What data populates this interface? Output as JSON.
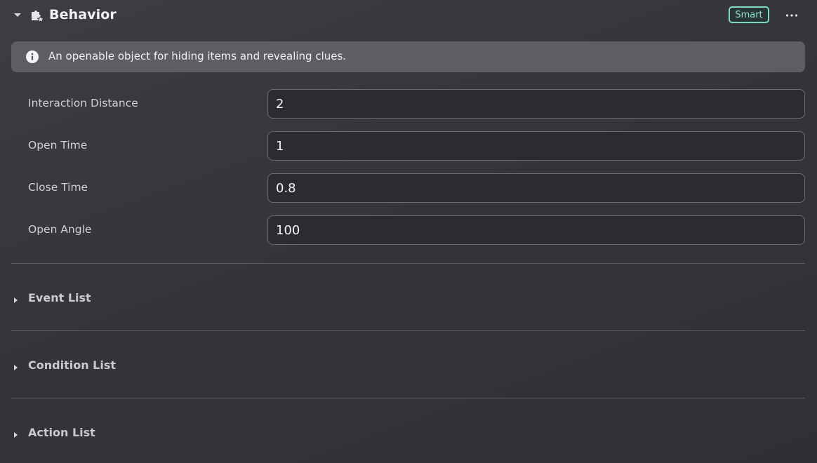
{
  "header": {
    "title": "Behavior",
    "badge": "Smart",
    "more_icon": "ellipsis-icon",
    "collapse_icon": "caret-down-icon",
    "behavior_icon": "puzzle-star-icon"
  },
  "info": {
    "icon": "info-circle-icon",
    "text": "An openable object for hiding items and revealing clues."
  },
  "properties": [
    {
      "label": "Interaction Distance",
      "value": "2"
    },
    {
      "label": "Open Time",
      "value": "1"
    },
    {
      "label": "Close Time",
      "value": "0.8"
    },
    {
      "label": "Open Angle",
      "value": "100"
    }
  ],
  "sections": [
    {
      "label": "Event List",
      "icon": "caret-right-icon"
    },
    {
      "label": "Condition List",
      "icon": "caret-right-icon"
    },
    {
      "label": "Action List",
      "icon": "caret-right-icon"
    }
  ],
  "colors": {
    "background": "#36373d",
    "badge_accent": "#7fd9c4",
    "info_banner": "#5d5e63"
  }
}
